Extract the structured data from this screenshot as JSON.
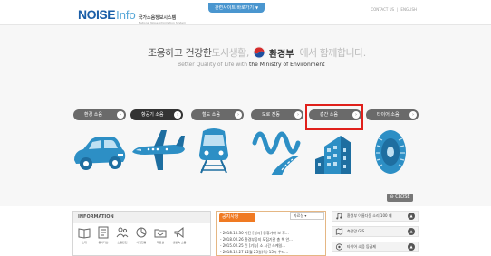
{
  "header": {
    "logo_main": "NOISE",
    "logo_accent": "Info",
    "logo_ko": "국가소음정보시스템",
    "logo_en": "National Noise Information System",
    "site_button": "관련사이트 바로가기",
    "links": [
      "CONTACT US",
      "ENGLISH"
    ]
  },
  "hero": {
    "slogan_a": "조용하고 건강한",
    "slogan_b": "도시생활,",
    "ministry_ko": "환경부",
    "slogan_d": "에서 함께합니다.",
    "slogan_en_a": "Better Quality of Life with",
    "slogan_en_b": "the Ministry of Environment"
  },
  "categories": [
    {
      "label": "환경 소음",
      "icon": "car-icon"
    },
    {
      "label": "항공기 소음",
      "icon": "airplane-icon"
    },
    {
      "label": "철도 소음",
      "icon": "train-icon"
    },
    {
      "label": "도로 진동",
      "icon": "road-vibration-icon"
    },
    {
      "label": "층간 소음",
      "icon": "building-icon"
    },
    {
      "label": "타이어 소음",
      "icon": "tire-icon"
    }
  ],
  "close_label": "CLOSE",
  "info": {
    "title": "INFORMATION",
    "items": [
      "소개",
      "용어기본",
      "소음관련",
      "사업현황",
      "자료실",
      "생활속 소음"
    ]
  },
  "notice": {
    "tab": "공지사항",
    "select": "자료실",
    "items": [
      "- 2018.10.30 기간 [일시] 공휴가마 보 후...",
      "- 2018.02.26 환경부공지 모집기관 총 책 안...",
      "- 2015.02.25 긴 [기능] 소 시간 스케일...",
      "- 2018.12.27 12월 25일(목) 15시 우리..."
    ]
  },
  "quick": [
    {
      "label": "환경부 이름다운 소리 100 제",
      "icon": "music-icon"
    },
    {
      "label": "측정망 GIS",
      "icon": "map-icon"
    },
    {
      "label": "타이어 소음 등급제",
      "icon": "tire-small-icon"
    }
  ],
  "colors": {
    "brand_blue": "#1b5fa8",
    "illustration_blue": "#2d8fc5",
    "notice_orange": "#f07a22",
    "highlight_red": "#e0201b"
  }
}
